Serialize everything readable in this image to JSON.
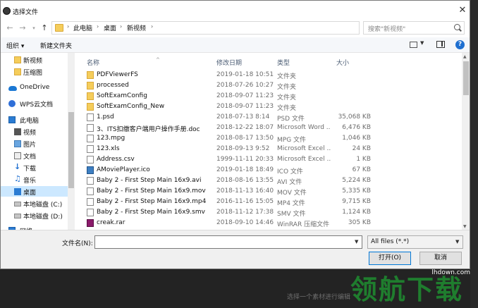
{
  "window": {
    "title": "选择文件"
  },
  "nav": {
    "breadcrumbs": [
      "此电脑",
      "桌面",
      "新视频"
    ],
    "search_placeholder": "搜索\"新视频\""
  },
  "toolbar": {
    "organize": "组织 ▾",
    "new_folder": "新建文件夹"
  },
  "sidebar": {
    "items": [
      {
        "label": "新视频",
        "icon": "folder-icon"
      },
      {
        "label": "压缩图",
        "icon": "folder-icon"
      },
      {
        "label": "OneDrive",
        "icon": "onedrive-icon"
      },
      {
        "label": "WPS云文档",
        "icon": "wps-cloud-icon"
      },
      {
        "label": "此电脑",
        "icon": "computer-icon"
      },
      {
        "label": "视频",
        "icon": "video-icon"
      },
      {
        "label": "图片",
        "icon": "pictures-icon"
      },
      {
        "label": "文档",
        "icon": "documents-icon"
      },
      {
        "label": "下载",
        "icon": "download-icon"
      },
      {
        "label": "音乐",
        "icon": "music-icon"
      },
      {
        "label": "桌面",
        "icon": "desktop-icon",
        "selected": true
      },
      {
        "label": "本地磁盘 (C:)",
        "icon": "drive-icon"
      },
      {
        "label": "本地磁盘 (D:)",
        "icon": "drive-icon"
      },
      {
        "label": "网络",
        "icon": "network-icon"
      }
    ]
  },
  "columns": {
    "name": "名称",
    "date": "修改日期",
    "type": "类型",
    "size": "大小"
  },
  "files": [
    {
      "name": "PDFViewerFS",
      "date": "2019-01-18 10:51",
      "type": "文件夹",
      "size": "",
      "kind": "folder"
    },
    {
      "name": "processed",
      "date": "2018-07-26 10:27",
      "type": "文件夹",
      "size": "",
      "kind": "folder"
    },
    {
      "name": "SoftExamConfig",
      "date": "2018-09-07 11:23",
      "type": "文件夹",
      "size": "",
      "kind": "folder"
    },
    {
      "name": "SoftExamConfig_New",
      "date": "2018-09-07 11:23",
      "type": "文件夹",
      "size": "",
      "kind": "folder"
    },
    {
      "name": "1.psd",
      "date": "2018-07-13 8:14",
      "type": "PSD 文件",
      "size": "35,068 KB",
      "kind": "file"
    },
    {
      "name": "3、ITS扣缴客户端用户操作手册.doc",
      "date": "2018-12-22 18:07",
      "type": "Microsoft Word ...",
      "size": "6,476 KB",
      "kind": "file"
    },
    {
      "name": "123.mpg",
      "date": "2018-08-17 13:50",
      "type": "MPG 文件",
      "size": "1,046 KB",
      "kind": "file"
    },
    {
      "name": "123.xls",
      "date": "2018-09-13 9:52",
      "type": "Microsoft Excel ...",
      "size": "24 KB",
      "kind": "file"
    },
    {
      "name": "Address.csv",
      "date": "1999-11-11 20:33",
      "type": "Microsoft Excel ...",
      "size": "1 KB",
      "kind": "file"
    },
    {
      "name": "AMoviePlayer.ico",
      "date": "2019-01-18 18:49",
      "type": "ICO 文件",
      "size": "67 KB",
      "kind": "ico"
    },
    {
      "name": "Baby 2 - First Step Main 16x9.avi",
      "date": "2018-08-16 13:55",
      "type": "AVI 文件",
      "size": "5,224 KB",
      "kind": "file"
    },
    {
      "name": "Baby 2 - First Step Main 16x9.mov",
      "date": "2018-11-13 16:40",
      "type": "MOV 文件",
      "size": "5,335 KB",
      "kind": "file"
    },
    {
      "name": "Baby 2 - First Step Main 16x9.mp4",
      "date": "2016-11-16 15:05",
      "type": "MP4 文件",
      "size": "9,715 KB",
      "kind": "file"
    },
    {
      "name": "Baby 2 - First Step Main 16x9.smv",
      "date": "2018-11-12 17:38",
      "type": "SMV 文件",
      "size": "1,124 KB",
      "kind": "file"
    },
    {
      "name": "creak.rar",
      "date": "2018-09-10 14:46",
      "type": "WinRAR 压缩文件",
      "size": "305 KB",
      "kind": "rar"
    }
  ],
  "footer": {
    "filename_label": "文件名(N):",
    "filename_value": "",
    "filter_value": "All files (*.*)",
    "open_label": "打开(O)",
    "cancel_label": "取消"
  },
  "watermark": {
    "site": "lhdown.com",
    "brand": "领航下载"
  },
  "background_hint": "选择一个素材进行编辑"
}
